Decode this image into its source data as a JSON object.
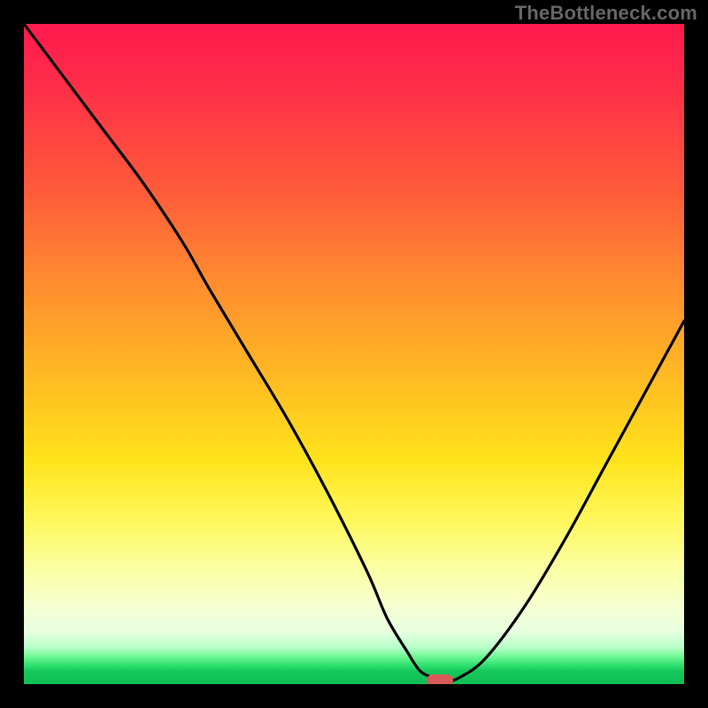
{
  "watermark": "TheBottleneck.com",
  "colors": {
    "frame_bg": "#000000",
    "curve_stroke": "#000000",
    "marker_fill": "#d85a5a"
  },
  "chart_data": {
    "type": "line",
    "title": "",
    "xlabel": "",
    "ylabel": "",
    "xlim": [
      0,
      100
    ],
    "ylim": [
      0,
      100
    ],
    "grid": false,
    "legend": false,
    "series": [
      {
        "name": "bottleneck-curve",
        "x": [
          0,
          6,
          12,
          18,
          24,
          28,
          34,
          40,
          46,
          52,
          55,
          58,
          60,
          62,
          64,
          66,
          70,
          76,
          82,
          88,
          94,
          100
        ],
        "y": [
          100,
          92,
          84,
          76,
          67,
          60,
          50,
          40,
          29,
          17,
          10,
          5,
          2,
          1,
          0.5,
          1,
          4,
          12,
          22,
          33,
          44,
          55
        ]
      }
    ],
    "marker": {
      "x": 63,
      "y": 0.5
    },
    "background_gradient": {
      "type": "vertical",
      "stops": [
        {
          "pos": 0,
          "color": "#ff1a4d"
        },
        {
          "pos": 25,
          "color": "#ff5a3a"
        },
        {
          "pos": 55,
          "color": "#ffbf22"
        },
        {
          "pos": 75,
          "color": "#fff75a"
        },
        {
          "pos": 92,
          "color": "#e8ffe0"
        },
        {
          "pos": 100,
          "color": "#0fbe54"
        }
      ]
    }
  }
}
